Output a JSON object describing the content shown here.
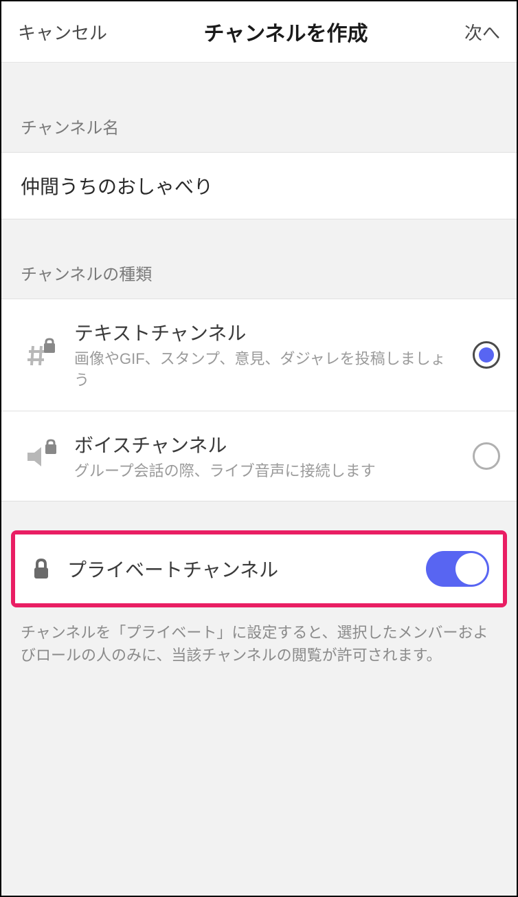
{
  "header": {
    "cancel": "キャンセル",
    "title": "チャンネルを作成",
    "next": "次へ"
  },
  "channelName": {
    "label": "チャンネル名",
    "value": "仲間うちのおしゃべり"
  },
  "channelType": {
    "label": "チャンネルの種類",
    "options": [
      {
        "title": "テキストチャンネル",
        "desc": "画像やGIF、スタンプ、意見、ダジャレを投稿しましょう",
        "selected": true
      },
      {
        "title": "ボイスチャンネル",
        "desc": "グループ会話の際、ライブ音声に接続します",
        "selected": false
      }
    ]
  },
  "private": {
    "label": "プライベートチャンネル",
    "enabled": true,
    "desc": "チャンネルを「プライベート」に設定すると、選択したメンバーおよびロールの人のみに、当該チャンネルの閲覧が許可されます。"
  }
}
